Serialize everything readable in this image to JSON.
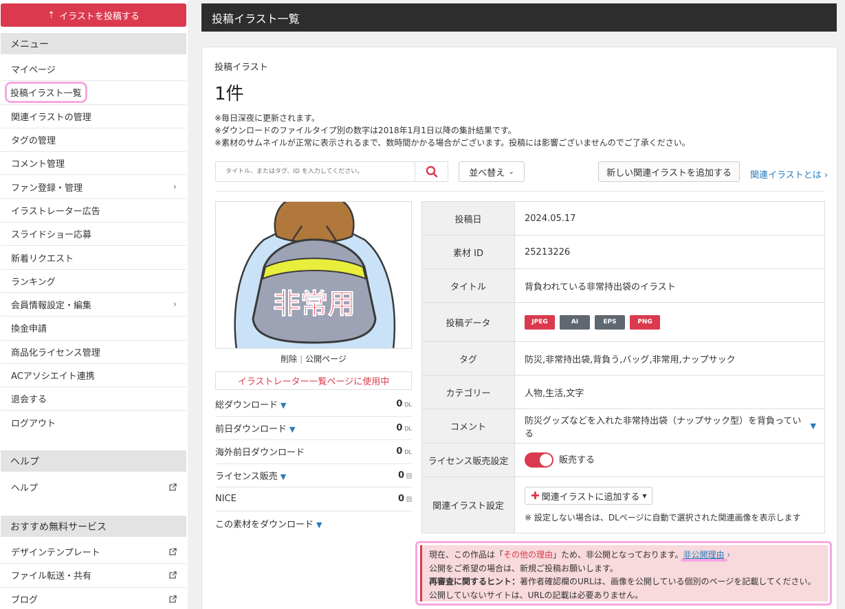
{
  "sidebar": {
    "upload_button": "イラストを投稿する",
    "menu_heading": "メニュー",
    "menu_items": [
      {
        "label": "マイページ"
      },
      {
        "label": "投稿イラスト一覧"
      },
      {
        "label": "関連イラストの管理"
      },
      {
        "label": "タグの管理"
      },
      {
        "label": "コメント管理"
      },
      {
        "label": "ファン登録・管理"
      },
      {
        "label": "イラストレーター広告"
      },
      {
        "label": "スライドショー応募"
      },
      {
        "label": "新着リクエスト"
      },
      {
        "label": "ランキング"
      },
      {
        "label": "会員情報設定・編集"
      },
      {
        "label": "換金申請"
      },
      {
        "label": "商品化ライセンス管理"
      },
      {
        "label": "ACアソシエイト連携"
      },
      {
        "label": "退会する"
      },
      {
        "label": "ログアウト"
      }
    ],
    "help_heading": "ヘルプ",
    "help_items": [
      {
        "label": "ヘルプ"
      }
    ],
    "services_heading": "おすすめ無料サービス",
    "service_items": [
      {
        "label": "デザインテンプレート"
      },
      {
        "label": "ファイル転送・共有"
      },
      {
        "label": "ブログ"
      }
    ]
  },
  "header": {
    "title": "投稿イラスト一覧"
  },
  "main": {
    "section_label": "投稿イラスト",
    "count": "1件",
    "notes": [
      "※毎日深夜に更新されます。",
      "※ダウンロードのファイルタイプ別の数字は2018年1月1日以降の集計結果です。",
      "※素材のサムネイルが正常に表示されるまで、数時間かかる場合がございます。投稿には影響ございませんのでご了承ください。"
    ],
    "search_placeholder": "タイトル、またはタグ、ID を入力してください。",
    "sort_label": "並べ替え",
    "add_related_label": "新しい関連イラストを追加する",
    "about_related_label": "関連イラストとは",
    "thumb_text": "非常用",
    "delete_label": "削除",
    "public_page_label": "公開ページ",
    "usage_badge": "イラストレーター一覧ページに使用中",
    "stats": [
      {
        "label": "総ダウンロード",
        "value": "0",
        "unit": "DL",
        "toggle": true
      },
      {
        "label": "前日ダウンロード",
        "value": "0",
        "unit": "DL",
        "toggle": true
      },
      {
        "label": "海外前日ダウンロード",
        "value": "0",
        "unit": "DL",
        "toggle": false
      },
      {
        "label": "ライセンス販売",
        "value": "0",
        "unit": "回",
        "toggle": true
      },
      {
        "label": "NICE",
        "value": "0",
        "unit": "回",
        "toggle": false
      }
    ],
    "download_material_label": "この素材をダウンロード",
    "info": {
      "posted_date_key": "投稿日",
      "posted_date": "2024.05.17",
      "material_id_key": "素材 ID",
      "material_id": "25213226",
      "title_key": "タイトル",
      "title": "背負われている非常持出袋のイラスト",
      "data_key": "投稿データ",
      "formats": [
        {
          "label": "JPEG",
          "color": "#db3a4e"
        },
        {
          "label": "AI",
          "color": "#5f6770"
        },
        {
          "label": "EPS",
          "color": "#5f6770"
        },
        {
          "label": "PNG",
          "color": "#db3a4e"
        }
      ],
      "tags_key": "タグ",
      "tags": "防災,非常持出袋,背負う,バッグ,非常用,ナップサック",
      "category_key": "カテゴリー",
      "category": "人物,生活,文字",
      "comment_key": "コメント",
      "comment": "防災グッズなどを入れた非常持出袋（ナップサック型）を背負っている",
      "license_key": "ライセンス販売設定",
      "license_value": "販売する",
      "related_key": "関連イラスト設定",
      "related_button": "関連イラストに追加する",
      "related_note": "※ 設定しない場合は、DLページに自動で選択された関連画像を表示します"
    },
    "alert": {
      "line1_prefix": "現在、この作品は「",
      "reason": "その他の理由",
      "line1_suffix": "」ため、非公開となっております。",
      "reason_link": "非公開理由",
      "line2": "公開をご希望の場合は、新規ご投稿お願いします。",
      "hint_label": "再審査に関するヒント：",
      "hint_text": "著作者確認欄のURLは、画像を公開している個別のページを記載してください。公開していないサイトは、URLの記載は必要ありません。"
    }
  }
}
